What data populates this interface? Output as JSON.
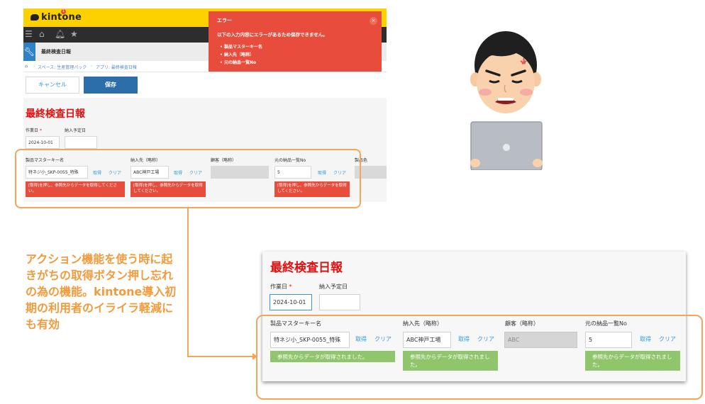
{
  "top_app": {
    "logo": "kintone",
    "app_title": "最終検査日報",
    "notification_count": "1",
    "breadcrumb": [
      "スペース: 生産管理パック",
      "アプリ: 最終検査日報"
    ],
    "cancel_label": "キャンセル",
    "save_label": "保存",
    "form_title": "最終検査日報",
    "work_date_label": "作業日",
    "required_mark": "*",
    "delivery_date_label": "納入予定日",
    "work_date_value": "2024-10-01",
    "fields": [
      {
        "label": "製品マスターキー名",
        "value": "特ネジ小_SKP-0055_特殊",
        "error": "[取得]を押し、参照先からデータを取得してください。"
      },
      {
        "label": "納入先（略称）",
        "value": "ABC神戸工場",
        "error": "[取得]を押し、参照先からデータを取得してください。"
      },
      {
        "label": "顧客（略称）",
        "value": ""
      },
      {
        "label": "元の納品一覧No",
        "value": "5",
        "error": "[取得]を押し、参照先からデータを取得してください。"
      },
      {
        "label": "製品色",
        "value": ""
      }
    ],
    "get_label": "取得",
    "clear_label": "クリア",
    "error_dialog": {
      "title": "エラー",
      "close": "×",
      "message": "以下の入力内容にエラーがあるため保存できません。",
      "items": [
        "製品マスターキー名",
        "納入先（略称）",
        "元の納品一覧No"
      ]
    }
  },
  "caption": "アクション機能を使う時に起きがちの取得ボタン押し忘れの為の機能。kintone導入初期の利用者のイライラ軽減にも有効",
  "bottom_app": {
    "form_title": "最終検査日報",
    "work_date_label": "作業日",
    "required_mark": "*",
    "delivery_date_label": "納入予定日",
    "work_date_value": "2024-10-01",
    "get_label": "取得",
    "clear_label": "クリア",
    "fields": [
      {
        "label": "製品マスターキー名",
        "value": "特ネジ小_SKP-0055_特殊",
        "status": "参照先からデータが取得されました。"
      },
      {
        "label": "納入先（略称）",
        "value": "ABC神戸工場",
        "status": "参照先からデータが取得されました。"
      },
      {
        "label": "顧客（略称）",
        "value": "ABC"
      },
      {
        "label": "元の納品一覧No",
        "value": "5",
        "status": "参照先からデータが取得されました。"
      }
    ]
  },
  "colors": {
    "kintone_yellow": "#fdd000",
    "error_red": "#e74c3c",
    "title_red": "#e3100f",
    "success_green": "#8fc66b",
    "annotation_orange": "#f5a45c",
    "link_blue": "#3498db"
  },
  "icons": [
    "menu-icon",
    "home-icon",
    "bell-icon",
    "star-icon",
    "wrench-icon",
    "close-icon",
    "frustrated-person-icon"
  ]
}
